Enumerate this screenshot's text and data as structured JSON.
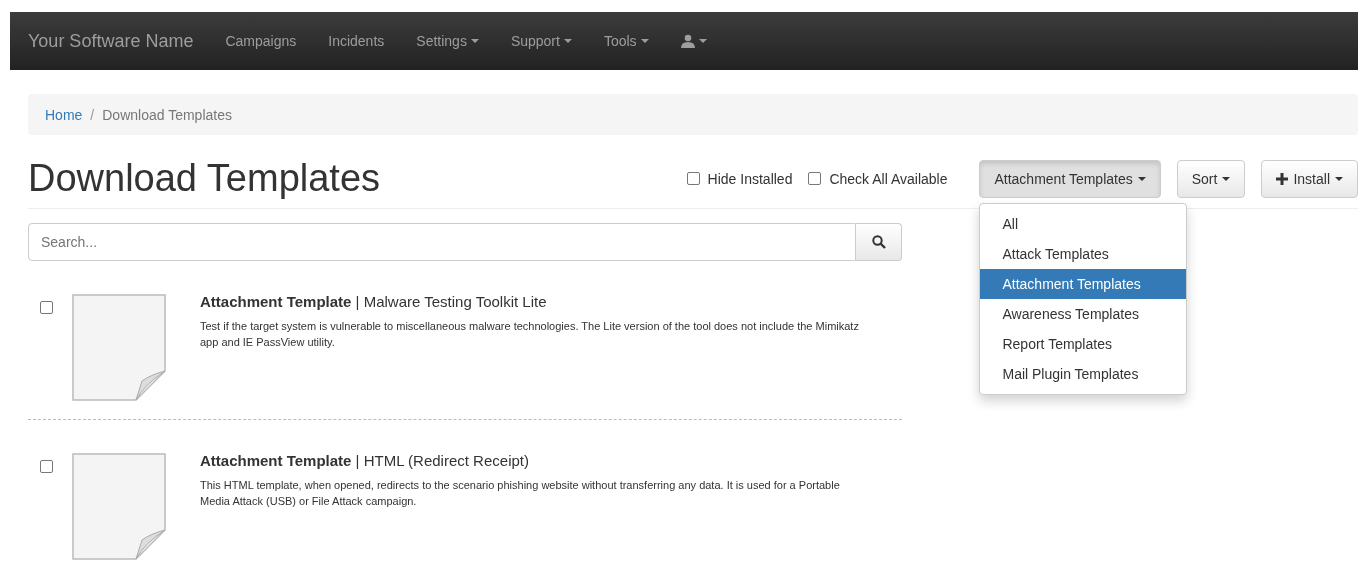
{
  "navbar": {
    "brand": "Your Software Name",
    "items": [
      {
        "label": "Campaigns",
        "dropdown": false
      },
      {
        "label": "Incidents",
        "dropdown": false
      },
      {
        "label": "Settings",
        "dropdown": true
      },
      {
        "label": "Support",
        "dropdown": true
      },
      {
        "label": "Tools",
        "dropdown": true
      }
    ],
    "user_menu": {
      "dropdown": true
    }
  },
  "breadcrumb": {
    "separator": "/",
    "items": [
      {
        "label": "Home",
        "link": true
      },
      {
        "label": "Download Templates",
        "link": false
      }
    ]
  },
  "title": "Download Templates",
  "toolbar": {
    "checkboxes": [
      {
        "label": "Hide Installed",
        "checked": false
      },
      {
        "label": "Check All Available",
        "checked": false
      }
    ],
    "filter": {
      "label": "Attachment Templates",
      "open": true,
      "options": [
        {
          "label": "All",
          "selected": false
        },
        {
          "label": "Attack Templates",
          "selected": false
        },
        {
          "label": "Attachment Templates",
          "selected": true
        },
        {
          "label": "Awareness Templates",
          "selected": false
        },
        {
          "label": "Report Templates",
          "selected": false
        },
        {
          "label": "Mail Plugin Templates",
          "selected": false
        }
      ]
    },
    "sort": {
      "label": "Sort"
    },
    "install": {
      "label": "Install"
    }
  },
  "search": {
    "placeholder": "Search..."
  },
  "templates": [
    {
      "title": "**Attachment Template** | Malware Testing Toolkit Lite",
      "description": "Test if the target system is vulnerable to miscellaneous malware technologies. The Lite version of the tool does not include the Mimikatz app and IE PassView utility.",
      "checked": false
    },
    {
      "title": "**Attachment Template** | HTML (Redirect Receipt)",
      "description": "This HTML template, when opened, redirects to the scenario phishing website without transferring any data. It is used for a Portable Media Attack (USB) or File Attack campaign.",
      "checked": false
    }
  ]
}
